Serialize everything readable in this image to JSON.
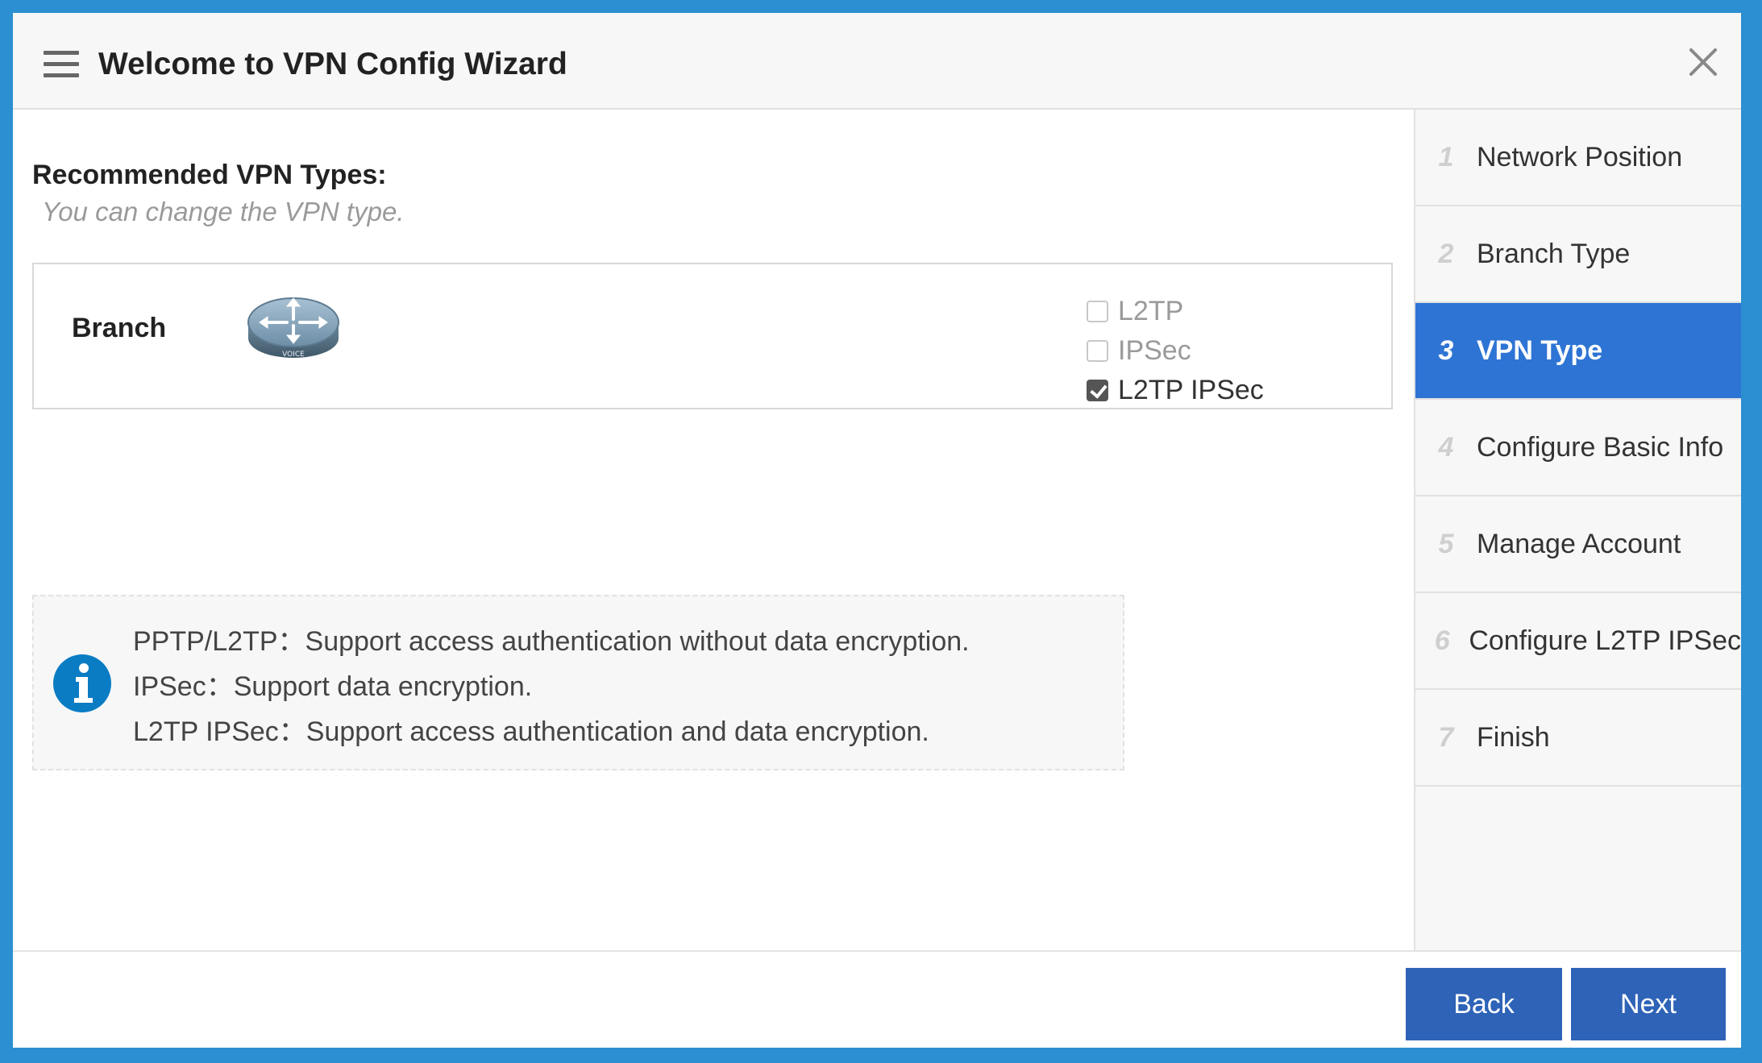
{
  "window": {
    "title": "Welcome to VPN Config Wizard"
  },
  "main": {
    "heading": "Recommended VPN Types:",
    "subheading": "You can change the VPN type.",
    "branch_label": "Branch",
    "router_icon_label": "VOICE",
    "options": [
      {
        "label": "L2TP",
        "checked": false
      },
      {
        "label": "IPSec",
        "checked": false
      },
      {
        "label": "L2TP IPSec",
        "checked": true
      }
    ],
    "info": [
      "PPTP/L2TP：Support access authentication without data encryption.",
      "IPSec：Support data encryption.",
      "L2TP IPSec：Support access authentication and data encryption."
    ]
  },
  "steps": [
    {
      "num": "1",
      "label": "Network Position"
    },
    {
      "num": "2",
      "label": "Branch Type"
    },
    {
      "num": "3",
      "label": "VPN Type",
      "active": true
    },
    {
      "num": "4",
      "label": "Configure Basic Info"
    },
    {
      "num": "5",
      "label": "Manage Account"
    },
    {
      "num": "6",
      "label": "Configure L2TP IPSec"
    },
    {
      "num": "7",
      "label": "Finish"
    }
  ],
  "footer": {
    "back_label": "Back",
    "next_label": "Next"
  },
  "colors": {
    "accent": "#2e74d4",
    "button": "#2e63b7",
    "frame": "#2b8fd1",
    "info_icon": "#0a7cc4"
  },
  "icons": [
    "menu-icon",
    "close-icon",
    "router-icon",
    "info-icon",
    "checkbox-icon"
  ]
}
